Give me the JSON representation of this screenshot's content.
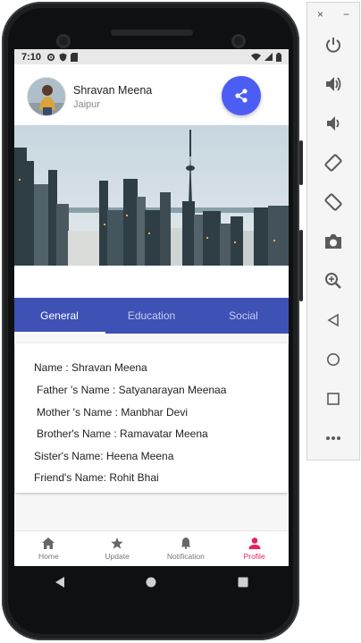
{
  "status_bar": {
    "time": "7:10"
  },
  "profile": {
    "name": "Shravan Meena",
    "location": "Jaipur"
  },
  "tabs": [
    {
      "label": "General",
      "active": true
    },
    {
      "label": "Education",
      "active": false
    },
    {
      "label": "Social",
      "active": false
    }
  ],
  "details": [
    "Name :  Shravan Meena",
    "Father 's Name : Satyanarayan Meenaa",
    "Mother 's Name : Manbhar Devi",
    "Brother's Name : Ramavatar Meena",
    "Sister's Name: Heena Meena",
    "Friend's Name: Rohit Bhai"
  ],
  "bottom_nav": [
    {
      "label": "Home",
      "icon": "home-icon",
      "active": false
    },
    {
      "label": "Update",
      "icon": "star-icon",
      "active": false
    },
    {
      "label": "Notification",
      "icon": "bell-icon",
      "active": false
    },
    {
      "label": "Profile",
      "icon": "person-icon",
      "active": true
    }
  ],
  "emulator_toolbar": {
    "close_symbol": "×",
    "minimize_symbol": "−",
    "buttons": [
      "power-icon",
      "volume-up-icon",
      "volume-down-icon",
      "rotate-left-icon",
      "rotate-right-icon",
      "camera-icon",
      "zoom-icon",
      "back-icon",
      "home-circle-icon",
      "overview-icon",
      "more-icon"
    ]
  },
  "colors": {
    "tab_bar": "#3e51b5",
    "share_button": "#4b5df3",
    "active_nav": "#e91e63"
  }
}
